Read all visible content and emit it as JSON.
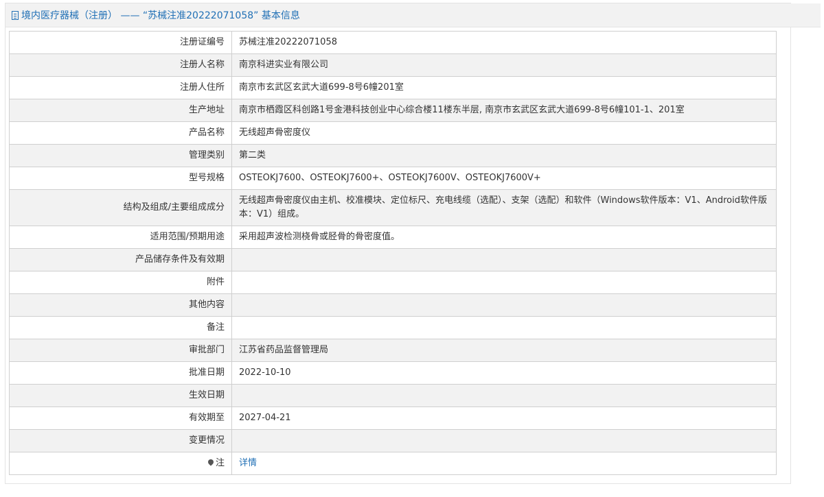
{
  "header": {
    "title": "境内医疗器械（注册） —— “苏械注准20222071058” 基本信息"
  },
  "rows": [
    {
      "label": "注册证编号",
      "value": "苏械注准20222071058"
    },
    {
      "label": "注册人名称",
      "value": "南京科进实业有限公司"
    },
    {
      "label": "注册人住所",
      "value": "南京市玄武区玄武大道699-8号6幢201室"
    },
    {
      "label": "生产地址",
      "value": "南京市栖霞区科创路1号金港科技创业中心综合楼11楼东半层, 南京市玄武区玄武大道699-8号6幢101-1、201室"
    },
    {
      "label": "产品名称",
      "value": "无线超声骨密度仪"
    },
    {
      "label": "管理类别",
      "value": "第二类"
    },
    {
      "label": "型号规格",
      "value": "OSTEOKJ7600、OSTEOKJ7600+、OSTEOKJ7600V、OSTEOKJ7600V+"
    },
    {
      "label": "结构及组成/主要组成成分",
      "value": "无线超声骨密度仪由主机、校准模块、定位标尺、充电线缆（选配）、支架（选配）和软件（Windows软件版本：V1、Android软件版本：V1）组成。"
    },
    {
      "label": "适用范围/预期用途",
      "value": "采用超声波检测桡骨或胫骨的骨密度值。"
    },
    {
      "label": "产品储存条件及有效期",
      "value": ""
    },
    {
      "label": "附件",
      "value": ""
    },
    {
      "label": "其他内容",
      "value": ""
    },
    {
      "label": "备注",
      "value": ""
    },
    {
      "label": "审批部门",
      "value": "江苏省药品监督管理局"
    },
    {
      "label": "批准日期",
      "value": "2022-10-10"
    },
    {
      "label": "生效日期",
      "value": ""
    },
    {
      "label": "有效期至",
      "value": "2027-04-21"
    },
    {
      "label": "变更情况",
      "value": ""
    },
    {
      "label": "注",
      "value": "详情",
      "icon": "location-pin-icon"
    }
  ],
  "colors": {
    "accent": "#1f6fb5",
    "row_alt": "#f2f2f2",
    "border": "#cfcfcf"
  }
}
